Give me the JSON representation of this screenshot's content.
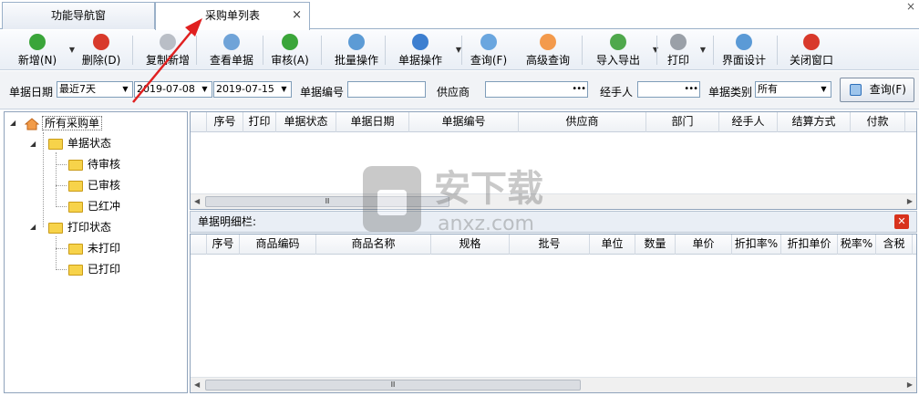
{
  "tabs": [
    {
      "label": "功能导航窗"
    },
    {
      "label": "采购单列表"
    }
  ],
  "window_close": "×",
  "tab_close": "×",
  "toolbar": [
    {
      "label": "新增(N)",
      "icon": "add-icon",
      "color": "#3aa53a",
      "dropdown": true
    },
    {
      "label": "删除(D)",
      "icon": "delete-icon",
      "color": "#d8392b"
    },
    {
      "label": "复制新增",
      "icon": "copy-icon",
      "color": "#b9bec6"
    },
    {
      "label": "查看单据",
      "icon": "view-icon",
      "color": "#6fa3d8"
    },
    {
      "label": "审核(A)",
      "icon": "approve-icon",
      "color": "#3aa53a"
    },
    {
      "label": "批量操作",
      "icon": "batch-icon",
      "color": "#5c9bd5"
    },
    {
      "label": "单据操作",
      "icon": "doc-action-icon",
      "color": "#3d7fd0",
      "dropdown": true
    },
    {
      "label": "查询(F)",
      "icon": "search-icon",
      "color": "#6aa6df"
    },
    {
      "label": "高级查询",
      "icon": "advanced-search-icon",
      "color": "#f39a4c"
    },
    {
      "label": "导入导出",
      "icon": "import-export-icon",
      "color": "#4fa84c",
      "dropdown": true
    },
    {
      "label": "打印",
      "icon": "print-icon",
      "color": "#9aa0a8",
      "dropdown": true
    },
    {
      "label": "界面设计",
      "icon": "layout-icon",
      "color": "#5b9ad6"
    },
    {
      "label": "关闭窗口",
      "icon": "close-window-icon",
      "color": "#d8392b"
    }
  ],
  "filter": {
    "date_label": "单据日期",
    "date_range": "最近7天",
    "date_from": "2019-07-08",
    "date_to": "2019-07-15",
    "docno_label": "单据编号",
    "docno_value": "",
    "supplier_label": "供应商",
    "supplier_value": "",
    "handler_label": "经手人",
    "handler_value": "",
    "type_label": "单据类别",
    "type_value": "所有",
    "query_btn": "查询(F)"
  },
  "tree": {
    "root": "所有采购单",
    "groups": [
      {
        "label": "单据状态",
        "children": [
          "待审核",
          "已审核",
          "已红冲"
        ]
      },
      {
        "label": "打印状态",
        "children": [
          "未打印",
          "已打印"
        ]
      }
    ]
  },
  "main_grid": {
    "columns": [
      "序号",
      "打印",
      "单据状态",
      "单据日期",
      "单据编号",
      "供应商",
      "部门",
      "经手人",
      "结算方式",
      "付款"
    ]
  },
  "detail_section": {
    "title": "单据明细栏:"
  },
  "detail_grid": {
    "columns": [
      "序号",
      "商品编码",
      "商品名称",
      "规格",
      "批号",
      "单位",
      "数量",
      "单价",
      "折扣率%",
      "折扣单价",
      "税率%",
      "含税"
    ]
  },
  "scroll_thumb": "Ⅲ",
  "watermark": {
    "cn": "安下载",
    "en": "anxz.com"
  }
}
